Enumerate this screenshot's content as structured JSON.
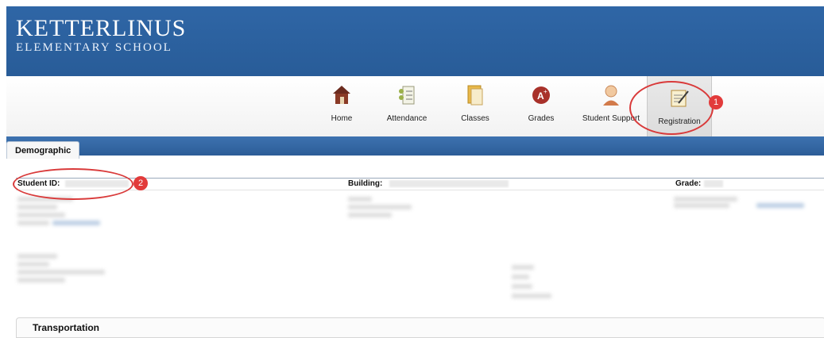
{
  "header": {
    "school_name": "KETTERLINUS",
    "school_sub": "ELEMENTARY SCHOOL"
  },
  "nav": {
    "items": [
      {
        "label": "Home",
        "icon": "home-icon"
      },
      {
        "label": "Attendance",
        "icon": "attendance-icon"
      },
      {
        "label": "Classes",
        "icon": "classes-icon"
      },
      {
        "label": "Grades",
        "icon": "grades-icon"
      },
      {
        "label": "Student Support",
        "icon": "student-support-icon"
      },
      {
        "label": "Registration",
        "icon": "registration-icon"
      }
    ],
    "active": "Registration"
  },
  "tabs": {
    "active_label": "Demographic"
  },
  "info": {
    "student_id_label": "Student ID:",
    "building_label": "Building:",
    "grade_label": "Grade:"
  },
  "sections": {
    "transportation_label": "Transportation"
  },
  "annotations": {
    "badge_1": "1",
    "badge_2": "2"
  },
  "colors": {
    "banner": "#2f66a6",
    "annotation": "#e23b3b"
  }
}
